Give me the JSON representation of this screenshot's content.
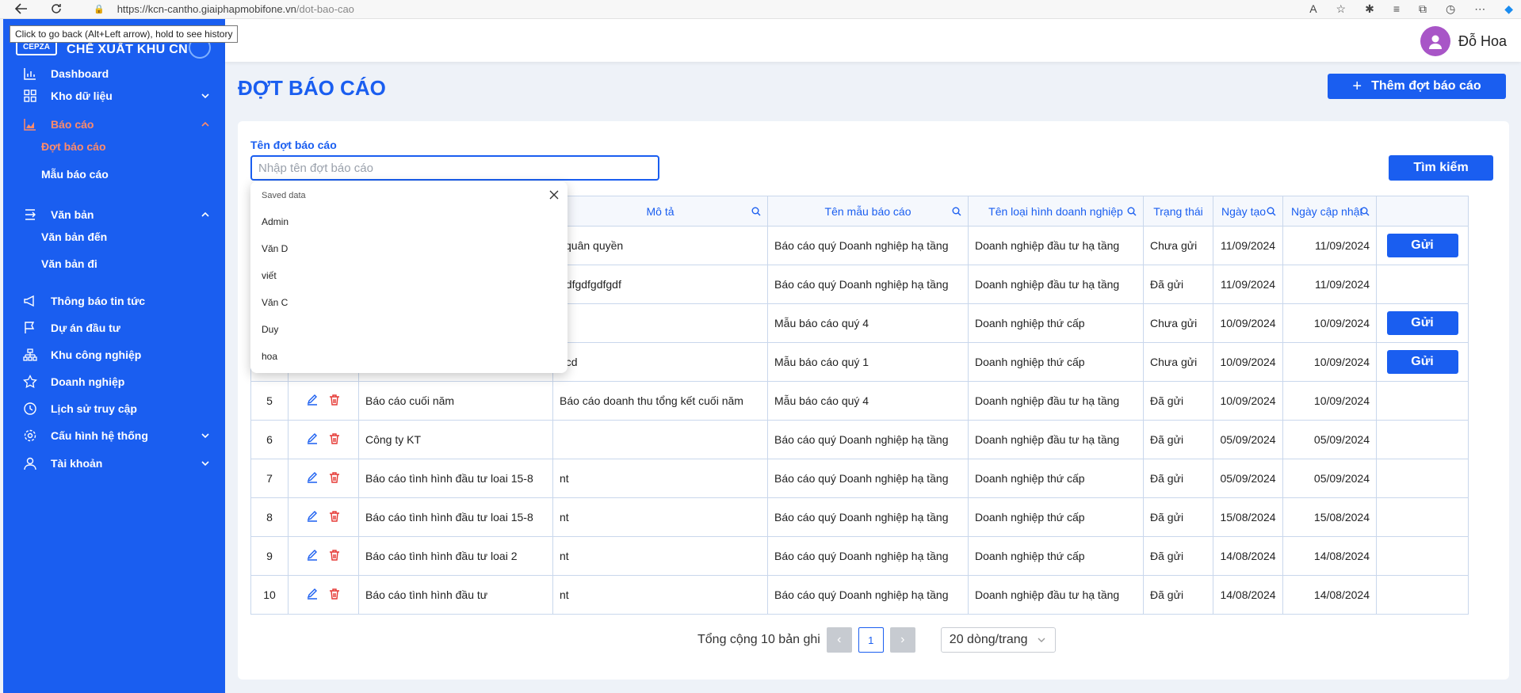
{
  "browser": {
    "url_host": "https://kcn-cantho.giaiphapmobifone.vn",
    "url_path": "/dot-bao-cao",
    "tooltip": "Click to go back (Alt+Left arrow), hold to see history"
  },
  "header": {
    "user_name": "Đỗ Hoa"
  },
  "sidebar": {
    "brand": "CHẾ XUẤT KHU CN",
    "items": [
      {
        "label": "Dashboard"
      },
      {
        "label": "Kho dữ liệu"
      },
      {
        "label": "Báo cáo"
      },
      {
        "label": "Văn bản"
      },
      {
        "label": "Thông báo tin tức"
      },
      {
        "label": "Dự án đầu tư"
      },
      {
        "label": "Khu công nghiệp"
      },
      {
        "label": "Doanh nghiệp"
      },
      {
        "label": "Lịch sử truy cập"
      },
      {
        "label": "Cấu hình hệ thống"
      },
      {
        "label": "Tài khoản"
      }
    ],
    "sub_bao_cao": [
      {
        "label": "Đợt báo cáo"
      },
      {
        "label": "Mẫu báo cáo"
      }
    ],
    "sub_van_ban": [
      {
        "label": "Văn bản đến"
      },
      {
        "label": "Văn bản đi"
      }
    ]
  },
  "main": {
    "title": "ĐỢT BÁO CÁO",
    "add_button": "Thêm đợt báo cáo",
    "search_label": "Tên đợt báo cáo",
    "search_placeholder": "Nhập tên đợt báo cáo",
    "search_button": "Tìm kiếm"
  },
  "table": {
    "headers": {
      "desc": "Mô tả",
      "template": "Tên mẫu báo cáo",
      "type": "Tên loại hình doanh nghiệp",
      "status": "Trạng thái",
      "created": "Ngày tạo",
      "updated": "Ngày cập nhật"
    },
    "send_label": "Gửi",
    "rows": [
      {
        "stt": "",
        "name": "",
        "desc": "i quân quyền",
        "template": "Báo cáo quý Doanh nghiệp hạ tầng",
        "type": "Doanh nghiệp đầu tư hạ tầng",
        "status": "Chưa gửi",
        "created": "11/09/2024",
        "updated": "11/09/2024"
      },
      {
        "stt": "",
        "name": "",
        "desc": "gdfgdfgdfgdf",
        "template": "Báo cáo quý Doanh nghiệp hạ tầng",
        "type": "Doanh nghiệp đầu tư hạ tầng",
        "status": "Đã gửi",
        "created": "11/09/2024",
        "updated": "11/09/2024"
      },
      {
        "stt": "",
        "name": "",
        "desc": "",
        "template": "Mẫu báo cáo quý 4",
        "type": "Doanh nghiệp thứ cấp",
        "status": "Chưa gửi",
        "created": "10/09/2024",
        "updated": "10/09/2024"
      },
      {
        "stt": "",
        "name": "",
        "desc": "ocd",
        "template": "Mẫu báo cáo quý 1",
        "type": "Doanh nghiệp thứ cấp",
        "status": "Chưa gửi",
        "created": "10/09/2024",
        "updated": "10/09/2024"
      },
      {
        "stt": "5",
        "name": "Báo cáo cuối năm",
        "desc": "Báo cáo doanh thu tổng kết cuối năm",
        "template": "Mẫu báo cáo quý 4",
        "type": "Doanh nghiệp đầu tư hạ tầng",
        "status": "Đã gửi",
        "created": "10/09/2024",
        "updated": "10/09/2024"
      },
      {
        "stt": "6",
        "name": "Công ty KT",
        "desc": "",
        "template": "Báo cáo quý Doanh nghiệp hạ tầng",
        "type": "Doanh nghiệp đầu tư hạ tầng",
        "status": "Đã gửi",
        "created": "05/09/2024",
        "updated": "05/09/2024"
      },
      {
        "stt": "7",
        "name": "Báo cáo tình hình đầu tư loai 15-8",
        "desc": "nt",
        "template": "Báo cáo quý Doanh nghiệp hạ tầng",
        "type": "Doanh nghiệp thứ cấp",
        "status": "Đã gửi",
        "created": "05/09/2024",
        "updated": "05/09/2024"
      },
      {
        "stt": "8",
        "name": "Báo cáo tình hình đầu tư loai 15-8",
        "desc": "nt",
        "template": "Báo cáo quý Doanh nghiệp hạ tầng",
        "type": "Doanh nghiệp thứ cấp",
        "status": "Đã gửi",
        "created": "15/08/2024",
        "updated": "15/08/2024"
      },
      {
        "stt": "9",
        "name": "Báo cáo tình hình đầu tư loai 2",
        "desc": "nt",
        "template": "Báo cáo quý Doanh nghiệp hạ tầng",
        "type": "Doanh nghiệp thứ cấp",
        "status": "Đã gửi",
        "created": "14/08/2024",
        "updated": "14/08/2024"
      },
      {
        "stt": "10",
        "name": "Báo cáo tình hình đầu tư",
        "desc": "nt",
        "template": "Báo cáo quý Doanh nghiệp hạ tầng",
        "type": "Doanh nghiệp đầu tư hạ tầng",
        "status": "Đã gửi",
        "created": "14/08/2024",
        "updated": "14/08/2024"
      }
    ]
  },
  "pagination": {
    "total": "Tổng cộng 10 bản ghi",
    "current": "1",
    "page_size": "20 dòng/trang"
  },
  "autofill": {
    "header": "Saved data",
    "items": [
      {
        "label": "Admin"
      },
      {
        "label": "Văn D"
      },
      {
        "label": "viết"
      },
      {
        "label": "Văn C"
      },
      {
        "label": "Duy"
      },
      {
        "label": "hoa"
      }
    ]
  },
  "colors": {
    "primary": "#1a5ef0",
    "active_menu": "#ff8b6a",
    "status_pending": "#16a34a",
    "status_sent": "#f5a623",
    "delete": "#e53935"
  }
}
